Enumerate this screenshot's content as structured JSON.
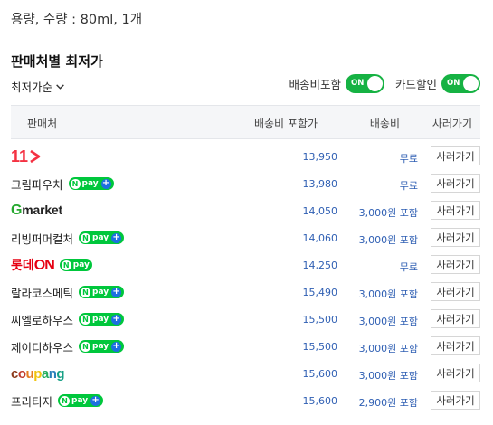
{
  "spec": "용량, 수량 : 80ml, 1개",
  "section_title": "판매처별 최저가",
  "sort": {
    "label": "최저가순"
  },
  "toggles": [
    {
      "label": "배송비포함",
      "state": "ON"
    },
    {
      "label": "카드할인",
      "state": "ON"
    }
  ],
  "table": {
    "headers": {
      "seller": "판매처",
      "price": "배송비 포함가",
      "shipping": "배송비",
      "buy": "사러가기"
    },
    "rows": [
      {
        "seller": "11st",
        "logo_text": "11",
        "npay": false,
        "price": "13,950",
        "shipping": "무료"
      },
      {
        "seller": "크림파우치",
        "npay": true,
        "price": "13,980",
        "shipping": "무료"
      },
      {
        "seller": "Gmarket",
        "logo_text": "market",
        "npay": false,
        "price": "14,050",
        "shipping": "3,000원 포함"
      },
      {
        "seller": "리빙퍼머컬처",
        "npay": true,
        "price": "14,060",
        "shipping": "3,000원 포함"
      },
      {
        "seller": "롯데ON",
        "logo_text": "롯데",
        "npay": true,
        "price": "14,250",
        "shipping": "무료"
      },
      {
        "seller": "랄라코스메틱",
        "npay": true,
        "price": "15,490",
        "shipping": "3,000원 포함"
      },
      {
        "seller": "씨엘로하우스",
        "npay": true,
        "price": "15,500",
        "shipping": "3,000원 포함"
      },
      {
        "seller": "제이디하우스",
        "npay": true,
        "price": "15,500",
        "shipping": "3,000원 포함"
      },
      {
        "seller": "coupang",
        "npay": false,
        "price": "15,600",
        "shipping": "3,000원 포함"
      },
      {
        "seller": "프리티지",
        "npay": true,
        "price": "15,600",
        "shipping": "2,900원 포함"
      }
    ],
    "buy_label": "사러가기",
    "npay_text": "pay"
  },
  "colors": {
    "toggle_on": "#16b243",
    "price_text": "#2f5fb3",
    "npay_green": "#00c73c",
    "npay_plus": "#1d6fe0"
  }
}
